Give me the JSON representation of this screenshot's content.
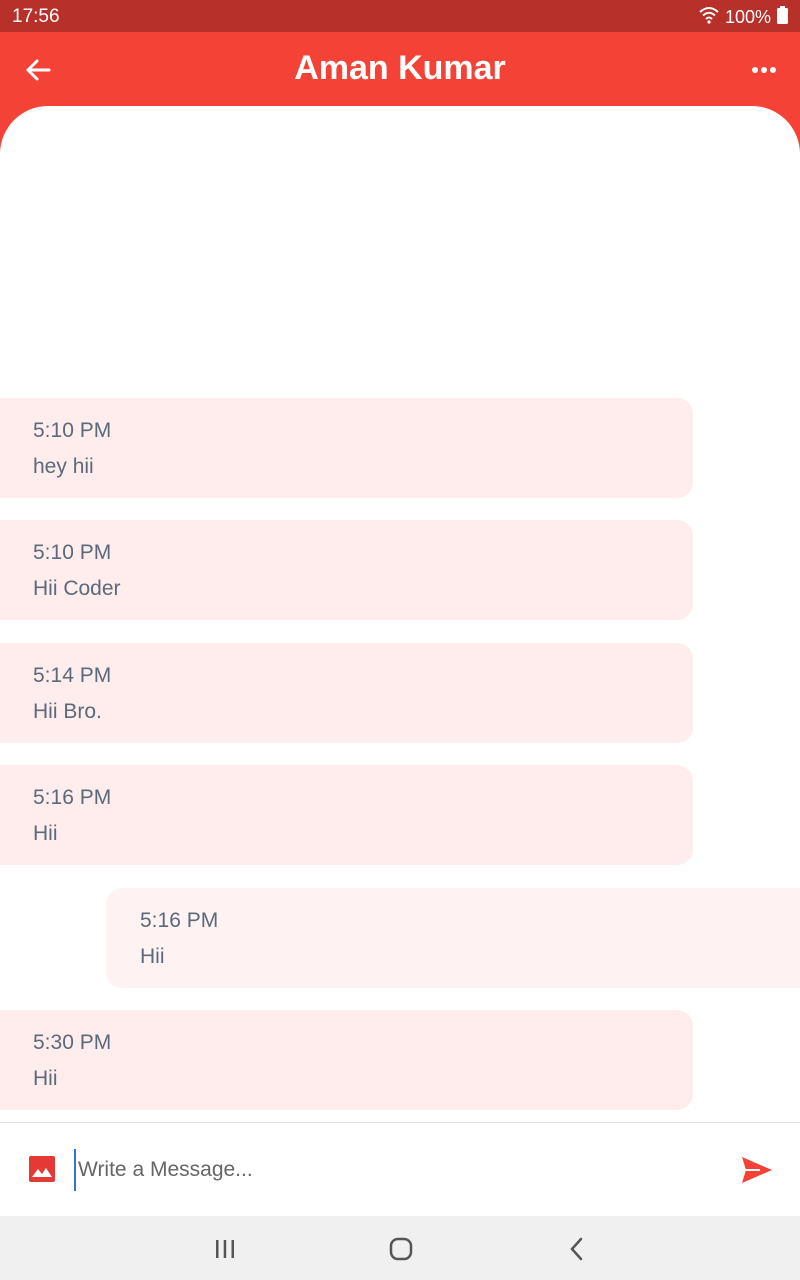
{
  "status_bar": {
    "time": "17:56",
    "battery": "100%",
    "icons": [
      "wifi-icon",
      "battery-icon"
    ]
  },
  "header": {
    "title": "Aman Kumar",
    "back_icon": "arrow-left-icon",
    "menu_icon": "more-horizontal-icon"
  },
  "messages": [
    {
      "direction": "incoming",
      "time": "5:10 PM",
      "text": "hey hii"
    },
    {
      "direction": "incoming",
      "time": "5:10 PM",
      "text": "Hii Coder"
    },
    {
      "direction": "incoming",
      "time": "5:14 PM",
      "text": "Hii Bro."
    },
    {
      "direction": "incoming",
      "time": "5:16 PM",
      "text": "Hii"
    },
    {
      "direction": "outgoing",
      "time": "5:16 PM",
      "text": "Hii"
    },
    {
      "direction": "incoming",
      "time": "5:30 PM",
      "text": "Hii"
    }
  ],
  "composer": {
    "placeholder": "Write a Message...",
    "value": "",
    "image_icon": "image-icon",
    "send_icon": "send-icon"
  },
  "nav_bar": {
    "icons": [
      "recents-icon",
      "home-icon",
      "back-icon"
    ]
  },
  "colors": {
    "primary": "#f44336",
    "status_bar": "#b8302a",
    "incoming_bubble": "#ffeded",
    "outgoing_bubble": "#fff2f2",
    "message_text": "#5a6a7a"
  }
}
